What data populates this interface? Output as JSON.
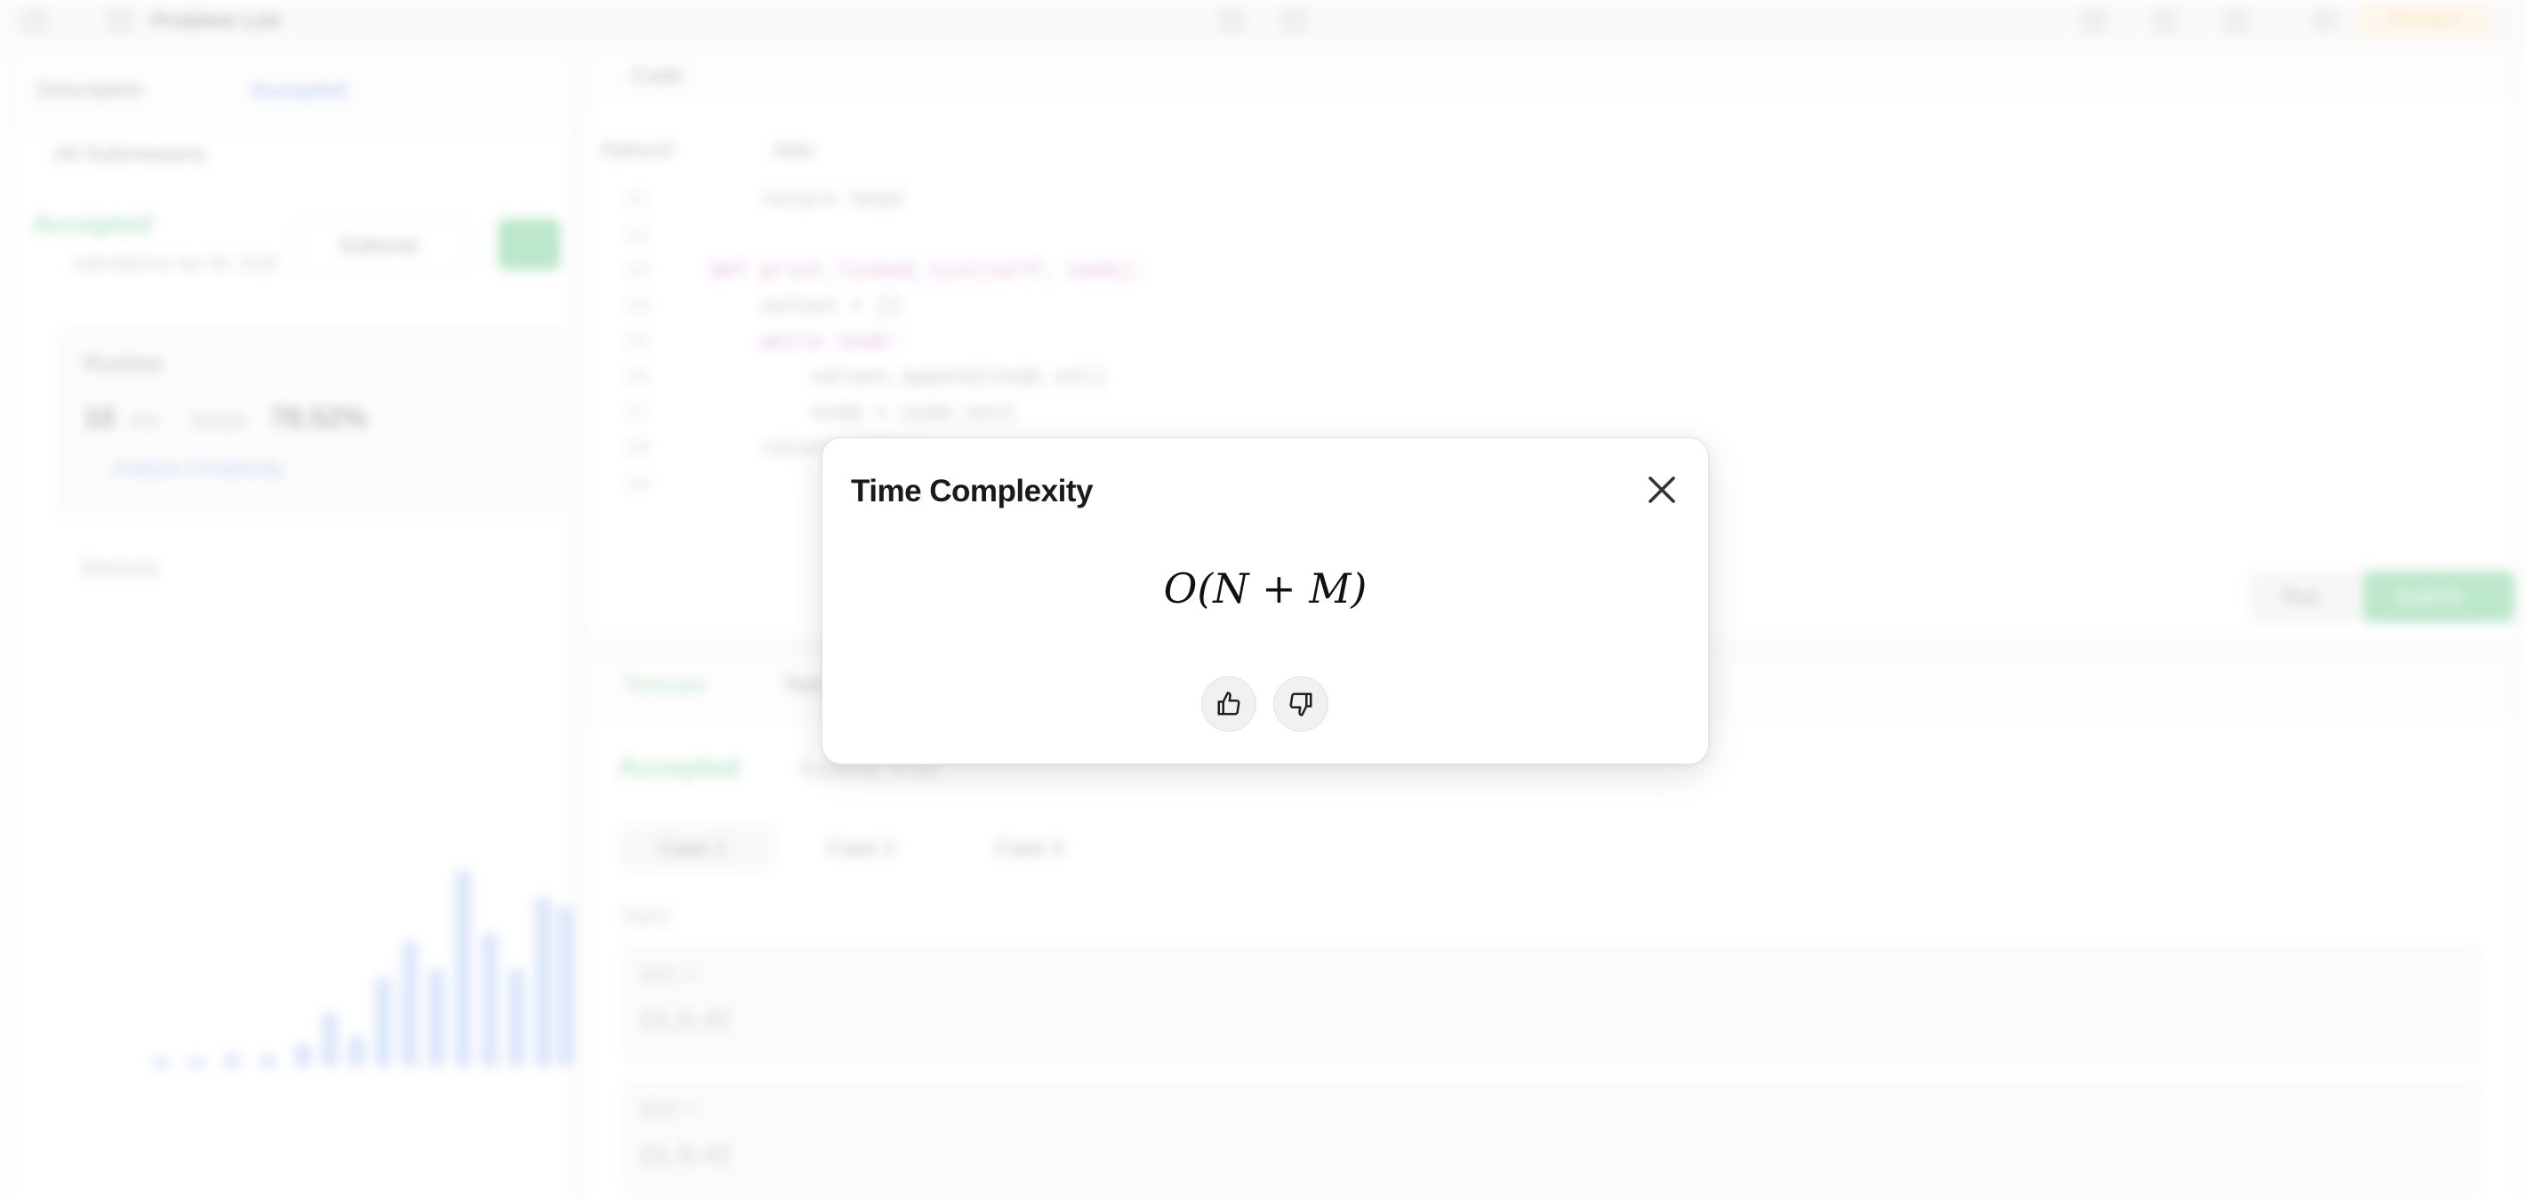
{
  "background": {
    "problem_list_label": "Problem List",
    "premium_label": "Premium",
    "left_tabs": [
      "Description",
      "Accepted"
    ],
    "back_label": "All Submissions",
    "status": "Accepted",
    "submitted_by": "submitted at Jan 30, 2025",
    "editorial_label": "Editorial",
    "runtime_title": "Runtime",
    "runtime_value": "10",
    "runtime_unit": "ms",
    "beats_label": "Beats",
    "beats_value": "78.52%",
    "analyze_label": "Analyze Complexity",
    "memory_title": "Memory",
    "code_title": "Code",
    "language": "Python3",
    "auto_label": "Auto",
    "code_lines": [
      {
        "n": "11",
        "text": "        return head"
      },
      {
        "n": "12",
        "text": ""
      },
      {
        "n": "13",
        "text": "    def print_linked_list(self, node):"
      },
      {
        "n": "14",
        "text": "        values = []"
      },
      {
        "n": "15",
        "text": "        while node:"
      },
      {
        "n": "16",
        "text": "            values.append(node.val)"
      },
      {
        "n": "17",
        "text": "            node = node.next"
      },
      {
        "n": "18",
        "text": "        return values"
      },
      {
        "n": "19",
        "text": ""
      }
    ],
    "run_label": "Run",
    "submit_label": "Submit",
    "testcase_label": "Testcase",
    "test_result_label": "Test Result",
    "accepted_label": "Accepted",
    "runtime_note": "Runtime: 0 ms",
    "cases": [
      "Case 1",
      "Case 2",
      "Case 3"
    ],
    "input_label": "Input",
    "list1_label": "list1 =",
    "list1_value": "[1,2,4]",
    "list2_label": "list2 =",
    "list2_value": "[1,3,4]"
  },
  "modal": {
    "title": "Time Complexity",
    "formula": "O(N + M)",
    "close_icon": "close-icon",
    "thumbs_up_icon": "thumbs-up-icon",
    "thumbs_down_icon": "thumbs-down-icon"
  }
}
